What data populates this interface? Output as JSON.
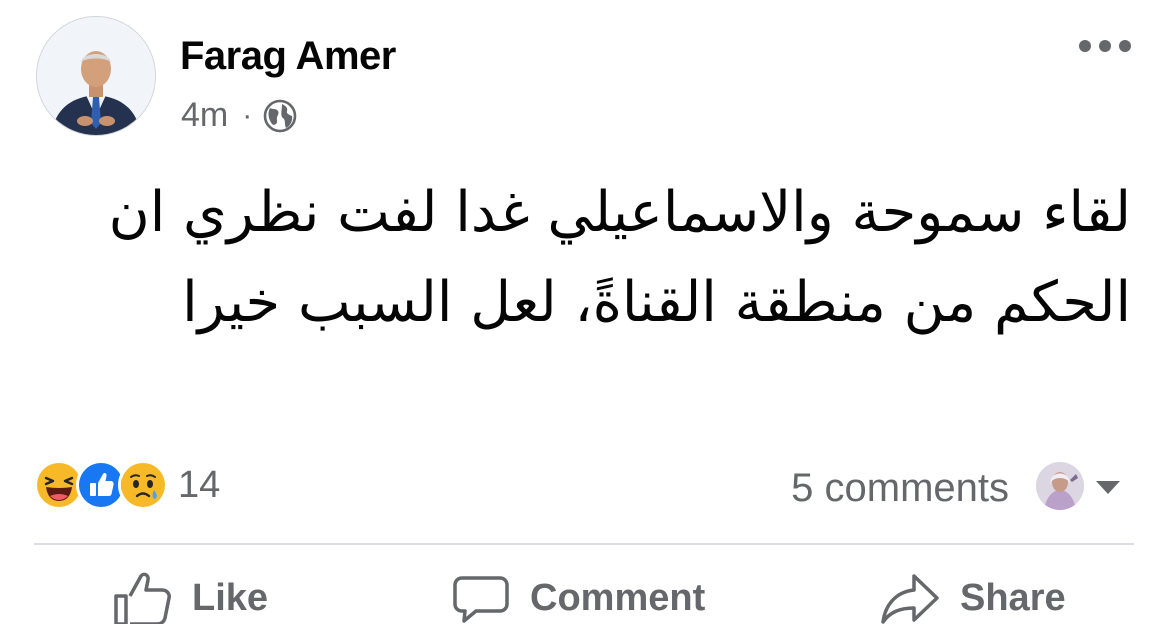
{
  "post": {
    "author": "Farag Amer",
    "time": "4m",
    "separator": "·",
    "privacy_icon": "globe-icon",
    "menu_icon": "more-options-icon",
    "text": "لقاء سموحة والاسماعيلي غدا لفت نظري ان الحكم من منطقة القناةً، لعل السبب خيرا",
    "reactions": {
      "types": [
        "haha",
        "like",
        "sad"
      ],
      "count": "14"
    },
    "comments_label": "5 comments"
  },
  "actions": {
    "like_label": "Like",
    "comment_label": "Comment",
    "share_label": "Share"
  },
  "colors": {
    "text_primary": "#050505",
    "text_secondary": "#65676b",
    "like_blue": "#1877f2",
    "emoji_yellow": "#f7b928",
    "divider": "#dadde1"
  }
}
